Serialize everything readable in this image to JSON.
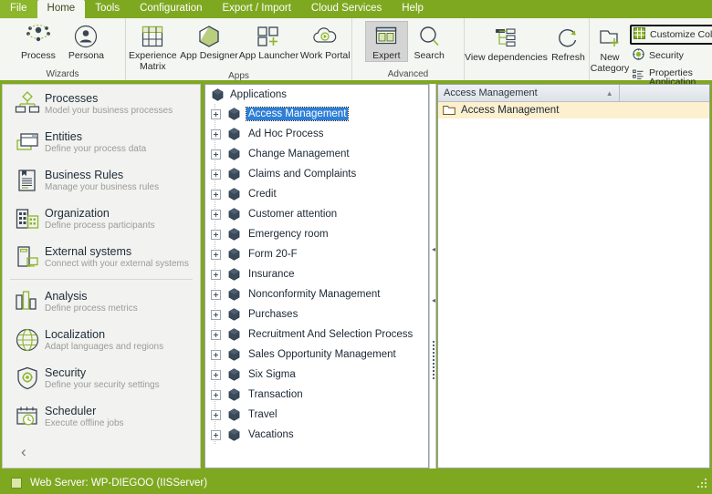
{
  "menu": {
    "items": [
      {
        "label": "File",
        "state": "file"
      },
      {
        "label": "Home",
        "state": "active"
      },
      {
        "label": "Tools",
        "state": "normal"
      },
      {
        "label": "Configuration",
        "state": "normal"
      },
      {
        "label": "Export / Import",
        "state": "normal"
      },
      {
        "label": "Cloud Services",
        "state": "normal"
      },
      {
        "label": "Help",
        "state": "normal"
      }
    ]
  },
  "ribbon": {
    "groups": [
      {
        "name": "Wizards",
        "label": "Wizards",
        "buttons": [
          {
            "label": "Process",
            "icon": "process-icon"
          },
          {
            "label": "Persona",
            "icon": "persona-icon"
          }
        ]
      },
      {
        "name": "Apps",
        "label": "Apps",
        "buttons": [
          {
            "label": "Experience Matrix",
            "icon": "experience-matrix-icon"
          },
          {
            "label": "App Designer",
            "icon": "app-designer-icon"
          },
          {
            "label": "App Launcher",
            "icon": "app-launcher-icon"
          },
          {
            "label": "Work Portal",
            "icon": "work-portal-icon"
          }
        ]
      },
      {
        "name": "Advanced",
        "label": "Advanced",
        "buttons": [
          {
            "label": "Expert",
            "icon": "expert-icon",
            "selected": true
          },
          {
            "label": "Search",
            "icon": "search-icon"
          }
        ]
      },
      {
        "name": "Dependencies",
        "label": "",
        "buttons": [
          {
            "label": "View dependencies",
            "icon": "view-dependencies-icon"
          },
          {
            "label": "Refresh",
            "icon": "refresh-icon"
          }
        ]
      },
      {
        "name": "Category",
        "label": "",
        "buttons": [
          {
            "label": "New Category",
            "icon": "new-category-icon"
          }
        ],
        "small_items": [
          {
            "label": "Customize Columns",
            "icon": "columns-icon",
            "highlighted": true
          },
          {
            "label": "Security",
            "icon": "security-icon",
            "highlighted": false
          },
          {
            "label": "Properties",
            "label2": "Application",
            "icon": "properties-icon",
            "highlighted": false
          }
        ]
      }
    ]
  },
  "sidebar": {
    "items": [
      {
        "title": "Processes",
        "subtitle": "Model your business processes",
        "icon": "processes-icon"
      },
      {
        "title": "Entities",
        "subtitle": "Define your process data",
        "icon": "entities-icon"
      },
      {
        "title": "Business  Rules",
        "subtitle": "Manage your business rules",
        "icon": "business-rules-icon"
      },
      {
        "title": "Organization",
        "subtitle": "Define process participants",
        "icon": "organization-icon"
      },
      {
        "title": "External systems",
        "subtitle": "Connect with your external systems",
        "icon": "external-systems-icon"
      },
      {
        "title": "Analysis",
        "subtitle": "Define  process  metrics",
        "icon": "analysis-icon"
      },
      {
        "title": "Localization",
        "subtitle": "Adapt  languages  and  regions",
        "icon": "localization-icon"
      },
      {
        "title": "Security",
        "subtitle": "Define  your  security  settings",
        "icon": "security-shield-icon"
      },
      {
        "title": "Scheduler",
        "subtitle": "Execute offline jobs",
        "icon": "scheduler-icon"
      }
    ],
    "collapse_glyph": "‹"
  },
  "tree": {
    "root": "Applications",
    "nodes": [
      {
        "label": "Access Management",
        "selected": true
      },
      {
        "label": "Ad Hoc Process",
        "selected": false
      },
      {
        "label": "Change Management",
        "selected": false
      },
      {
        "label": "Claims and Complaints",
        "selected": false
      },
      {
        "label": "Credit",
        "selected": false
      },
      {
        "label": "Customer attention",
        "selected": false
      },
      {
        "label": "Emergency room",
        "selected": false
      },
      {
        "label": "Form 20-F",
        "selected": false
      },
      {
        "label": "Insurance",
        "selected": false
      },
      {
        "label": "Nonconformity Management",
        "selected": false
      },
      {
        "label": "Purchases",
        "selected": false
      },
      {
        "label": "Recruitment And Selection Process",
        "selected": false
      },
      {
        "label": "Sales Opportunity Management",
        "selected": false
      },
      {
        "label": "Six Sigma",
        "selected": false
      },
      {
        "label": "Transaction",
        "selected": false
      },
      {
        "label": "Travel",
        "selected": false
      },
      {
        "label": "Vacations",
        "selected": false
      }
    ]
  },
  "grid": {
    "columns": [
      {
        "label": "Access Management",
        "sort": "▲"
      },
      {
        "label": ""
      }
    ],
    "rows": [
      {
        "label": "Access Management",
        "icon": "folder-icon"
      }
    ]
  },
  "status": {
    "text": "Web Server: WP-DIEGOO (IISServer)"
  },
  "colors": {
    "brand_green": "#7fa821",
    "file_tab_green": "#8cb62b",
    "ribbon_bg": "#f4f6f2",
    "selection_blue": "#2f7fd6",
    "row_highlight": "#fdf0cf",
    "icon_navy": "#2f3f4f",
    "icon_green": "#8cb62b"
  }
}
